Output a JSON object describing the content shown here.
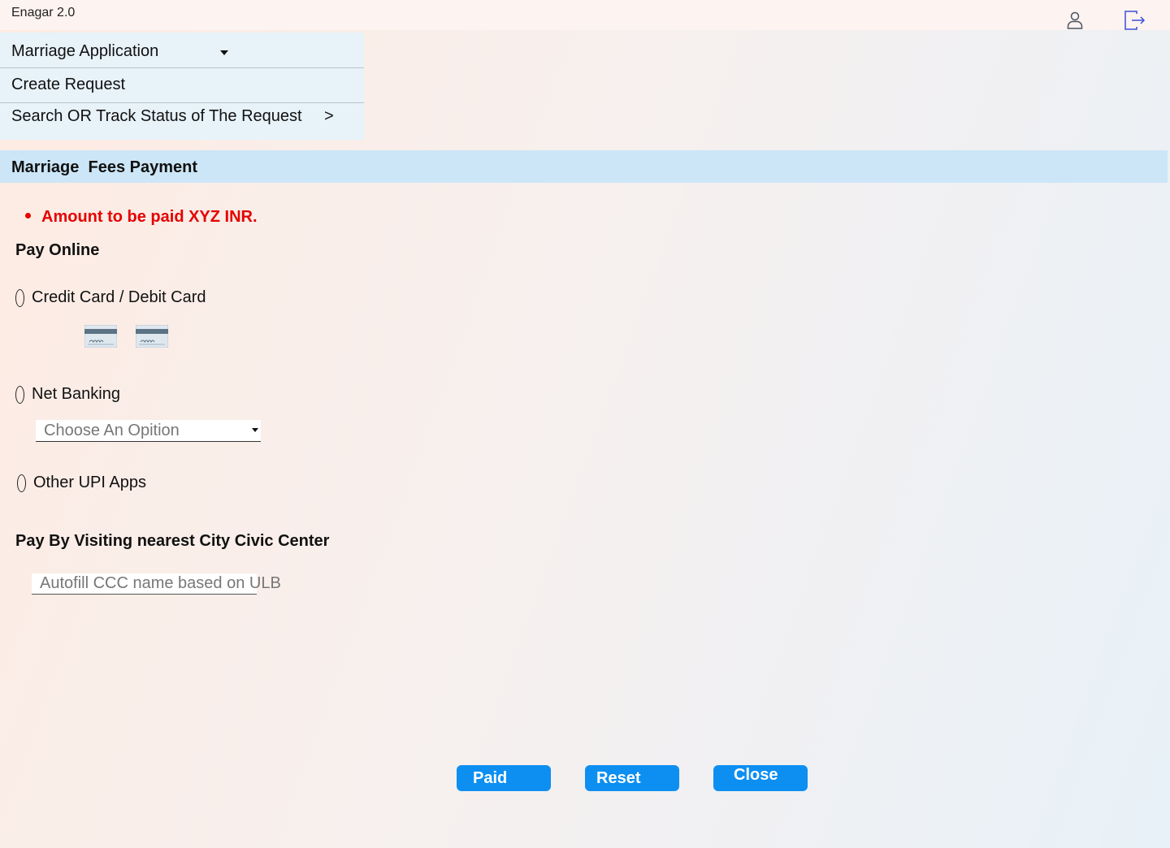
{
  "app": {
    "title": "Enagar 2.0"
  },
  "header": {
    "user_icon": "user-icon",
    "logout_icon": "logout-icon"
  },
  "menu": {
    "items": [
      {
        "label": "Marriage Application",
        "indicator": "caret-down"
      },
      {
        "label": "Create Request"
      },
      {
        "label": "Search OR Track Status of The Request",
        "indicator": ">"
      }
    ]
  },
  "section": {
    "title": "Marriage  Fees Payment"
  },
  "notice": {
    "amount_text": "Amount to be paid XYZ INR.",
    "color": "#e60000"
  },
  "pay_online": {
    "heading": "Pay Online",
    "options": [
      {
        "label": "Credit Card / Debit Card",
        "icons": [
          "credit-card-icon",
          "debit-card-icon"
        ]
      },
      {
        "label": "Net Banking",
        "select_placeholder": "Choose An Opition"
      },
      {
        "label": "Other UPI Apps"
      }
    ]
  },
  "pay_offline": {
    "heading": "Pay By Visiting nearest City Civic Center",
    "ccc_placeholder": "Autofill CCC name based on ULB"
  },
  "buttons": {
    "paid": "Paid",
    "reset": "Reset",
    "close": "Close",
    "color": "#0d8ff2"
  }
}
